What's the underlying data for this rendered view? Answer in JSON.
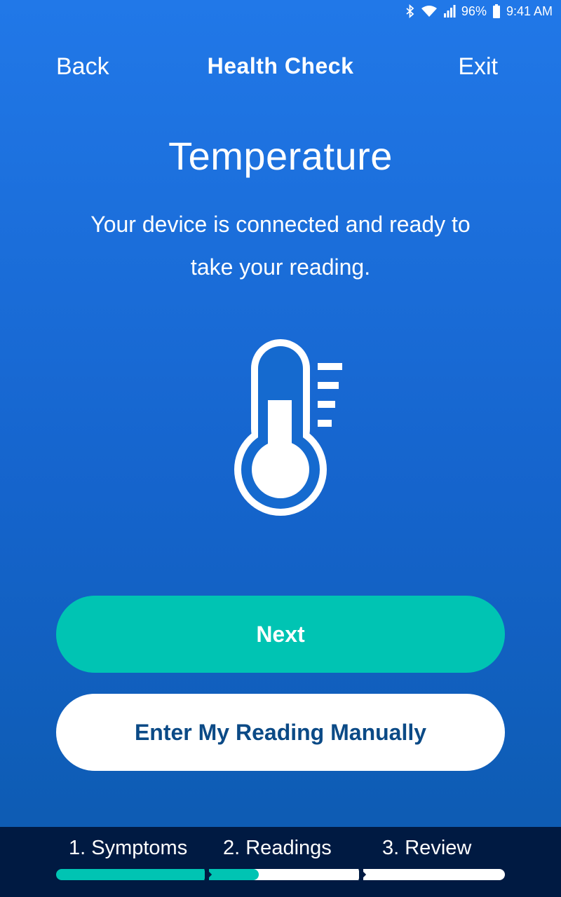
{
  "status_bar": {
    "battery": "96%",
    "time": "9:41 AM",
    "icons": [
      "bluetooth-icon",
      "wifi-icon",
      "signal-icon",
      "battery-icon"
    ]
  },
  "nav": {
    "back_label": "Back",
    "title": "Health Check",
    "exit_label": "Exit"
  },
  "content": {
    "heading": "Temperature",
    "description": "Your device is connected and ready to take your reading.",
    "icon": "thermometer-icon"
  },
  "actions": {
    "next_label": "Next",
    "manual_label": "Enter My Reading Manually"
  },
  "progress": {
    "steps": [
      {
        "label": "1. Symptoms",
        "complete": 1.0
      },
      {
        "label": "2. Readings",
        "complete": 0.33
      },
      {
        "label": "3. Review",
        "complete": 0.0
      }
    ]
  },
  "colors": {
    "accent": "#00c4b3",
    "background_top": "#2178e8",
    "background_bottom": "#0c5aae",
    "footer": "#001a42",
    "manual_text": "#0b4a86"
  }
}
